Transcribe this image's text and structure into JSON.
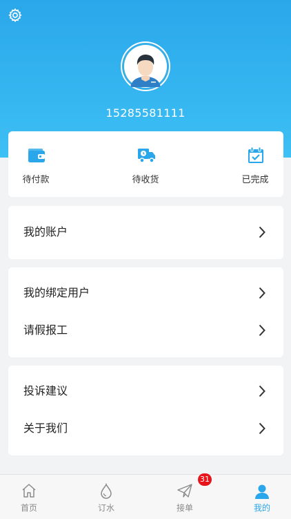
{
  "profile": {
    "phone": "15285581111",
    "settings_icon": "gear-icon",
    "avatar_icon": "user-avatar-icon"
  },
  "orders": [
    {
      "label": "待付款",
      "icon": "wallet-icon"
    },
    {
      "label": "待收货",
      "icon": "delivery-truck-icon"
    },
    {
      "label": "已完成",
      "icon": "calendar-check-icon"
    }
  ],
  "menu": {
    "group1": [
      {
        "label": "我的账户"
      }
    ],
    "group2": [
      {
        "label": "我的绑定用户"
      },
      {
        "label": "请假报工"
      }
    ],
    "group3": [
      {
        "label": "投诉建议"
      },
      {
        "label": "关于我们"
      }
    ]
  },
  "tabbar": {
    "tabs": [
      {
        "label": "首页",
        "icon": "home-icon"
      },
      {
        "label": "订水",
        "icon": "water-drop-icon"
      },
      {
        "label": "接单",
        "icon": "paper-plane-icon",
        "badge": "31"
      },
      {
        "label": "我的",
        "icon": "person-icon",
        "active": true
      }
    ]
  },
  "colors": {
    "accent": "#2aa7ea",
    "badge": "#e8141c",
    "background": "#f2f3f5"
  }
}
